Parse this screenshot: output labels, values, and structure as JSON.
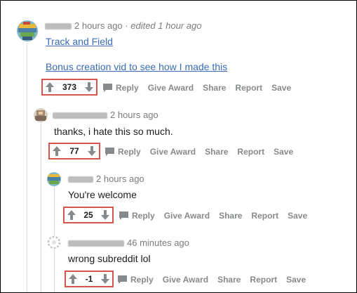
{
  "colors": {
    "vote_highlight": "#d9534f",
    "link": "#3a6db5",
    "meta": "#7c7c7c",
    "action": "#878a8c"
  },
  "comments": [
    {
      "time": "2 hours ago",
      "edited": "edited 1 hour ago",
      "links": [
        "Track and Field",
        "Bonus creation vid to see how I made this"
      ],
      "score": "373",
      "actions": {
        "reply": "Reply",
        "give_award": "Give Award",
        "share": "Share",
        "report": "Report",
        "save": "Save"
      }
    },
    {
      "time": "2 hours ago",
      "text": "thanks, i hate this so much.",
      "score": "77",
      "actions": {
        "reply": "Reply",
        "give_award": "Give Award",
        "share": "Share",
        "report": "Report",
        "save": "Save"
      }
    },
    {
      "time": "2 hours ago",
      "text": "You're welcome",
      "score": "25",
      "actions": {
        "reply": "Reply",
        "give_award": "Give Award",
        "share": "Share",
        "report": "Report",
        "save": "Save"
      }
    },
    {
      "time": "46 minutes ago",
      "text": "wrong subreddit lol",
      "score": "-1",
      "actions": {
        "reply": "Reply",
        "give_award": "Give Award",
        "share": "Share",
        "report": "Report",
        "save": "Save"
      }
    }
  ]
}
